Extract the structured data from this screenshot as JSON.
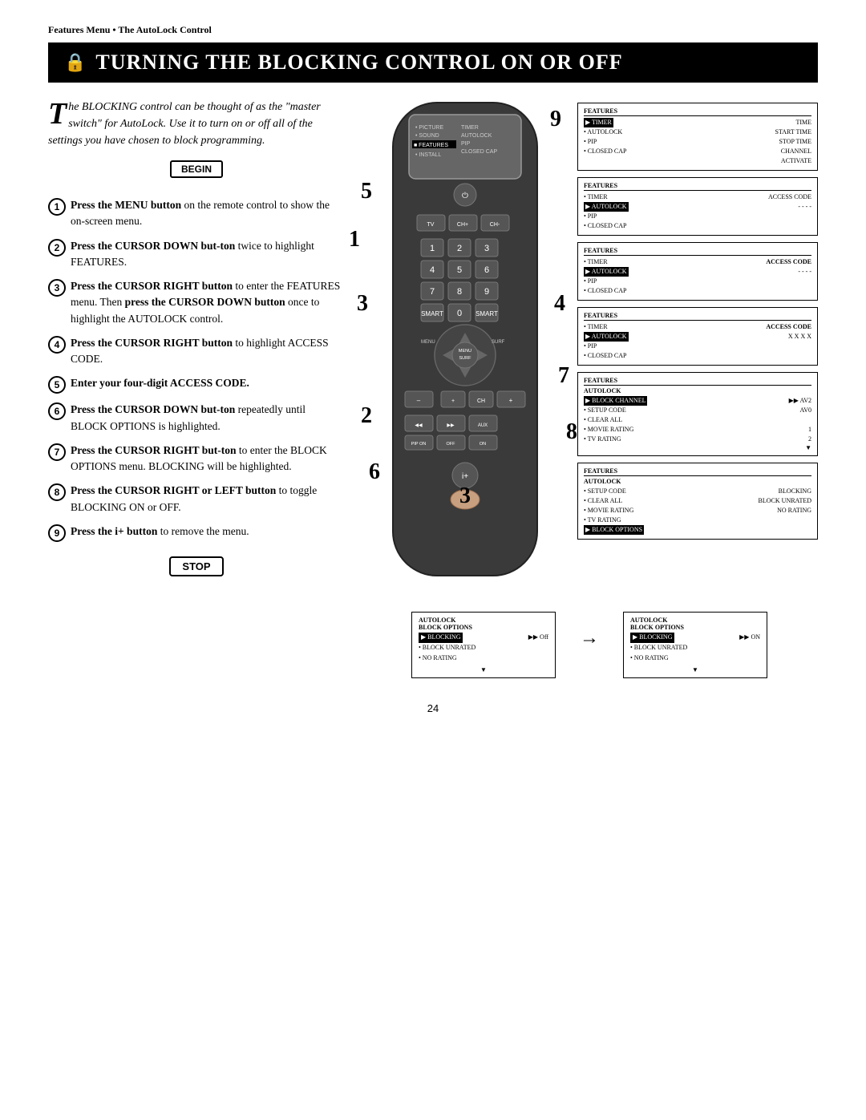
{
  "header": {
    "label": "Features Menu • The AutoLock Control"
  },
  "title": "Turning the Blocking Control On or Off",
  "intro": {
    "drop_cap": "T",
    "text": "he BLOCKING control can be thought of as the \"master switch\" for AutoLock. Use it to turn on or off all of the settings you have chosen to block programming."
  },
  "begin_label": "BEGIN",
  "stop_label": "STOP",
  "steps": [
    {
      "num": "1",
      "text_bold": "Press the MENU button",
      "text_rest": " on the remote control to show the on-screen menu."
    },
    {
      "num": "2",
      "text_bold": "Press the CURSOR DOWN but-ton",
      "text_rest": " twice to highlight FEATURES."
    },
    {
      "num": "3",
      "text_bold": "Press the CURSOR RIGHT button",
      "text_rest": " to enter the FEATURES menu. Then ",
      "text_bold2": "press the CURSOR DOWN button",
      "text_rest2": " once to highlight the AUTOLOCK control."
    },
    {
      "num": "4",
      "text_bold": "Press the CURSOR RIGHT button",
      "text_rest": " to highlight ACCESS CODE."
    },
    {
      "num": "5",
      "text_bold": "Enter your four-digit ACCESS CODE."
    },
    {
      "num": "6",
      "text_bold": "Press the CURSOR DOWN but-ton",
      "text_rest": " repeatedly until BLOCK OPTIONS is highlighted."
    },
    {
      "num": "7",
      "text_bold": "Press the CURSOR RIGHT but-ton",
      "text_rest": " to enter the BLOCK OPTIONS menu. BLOCKING will be highlighted."
    },
    {
      "num": "8",
      "text_bold": "Press the CURSOR RIGHT or LEFT button",
      "text_rest": " to toggle BLOCKING ON or OFF."
    },
    {
      "num": "9",
      "text_bold": "Press the i+ button",
      "text_rest": " to remove the menu."
    }
  ],
  "panels": [
    {
      "id": "panel1",
      "title": "FEATURES",
      "rows": [
        {
          "label": "▶ TIMER",
          "value": "TIME",
          "highlighted": true
        },
        {
          "label": "• AUTOLOCK",
          "value": "START TIME",
          "highlighted": false
        },
        {
          "label": "• PIP",
          "value": "STOP TIME",
          "highlighted": false
        },
        {
          "label": "• CLOSED CAP",
          "value": "CHANNEL",
          "highlighted": false
        },
        {
          "label": "",
          "value": "ACTIVATE",
          "highlighted": false
        }
      ]
    },
    {
      "id": "panel2",
      "title": "FEATURES",
      "rows": [
        {
          "label": "• TIMER",
          "value": "ACCESS CODE",
          "highlighted": false
        },
        {
          "label": "▶ AUTOLOCK",
          "value": "- - - -",
          "highlighted": true
        },
        {
          "label": "• PIP",
          "value": "",
          "highlighted": false
        },
        {
          "label": "• CLOSED CAP",
          "value": "",
          "highlighted": false
        }
      ]
    },
    {
      "id": "panel3",
      "title": "FEATURES",
      "rows": [
        {
          "label": "• TIMER",
          "value": "ACCESS CODE",
          "highlighted": false
        },
        {
          "label": "▶ AUTOLOCK",
          "value": "- - - -",
          "highlighted": true
        },
        {
          "label": "• PIP",
          "value": "",
          "highlighted": false
        },
        {
          "label": "• CLOSED CAP",
          "value": "",
          "highlighted": false
        }
      ]
    },
    {
      "id": "panel4",
      "title": "FEATURES",
      "rows": [
        {
          "label": "• TIMER",
          "value": "ACCESS CODE",
          "highlighted": false
        },
        {
          "label": "▶ AUTOLOCK",
          "value": "X X X X",
          "highlighted": true
        },
        {
          "label": "• PIP",
          "value": "",
          "highlighted": false
        },
        {
          "label": "• CLOSED CAP",
          "value": "",
          "highlighted": false
        }
      ]
    },
    {
      "id": "panel5",
      "title": "FEATURES",
      "sub_title": "AUTOLOCK",
      "rows": [
        {
          "label": "▶ BLOCK CHANNEL",
          "value": "▶▶ AV2",
          "highlighted": true
        },
        {
          "label": "• SETUP CODE",
          "value": "AV0",
          "highlighted": false
        },
        {
          "label": "• CLEAR ALL",
          "value": "",
          "highlighted": false
        },
        {
          "label": "• MOVIE RATING",
          "value": "1",
          "highlighted": false
        },
        {
          "label": "• TV RATING",
          "value": "2",
          "highlighted": false
        },
        {
          "label": "",
          "value": "▼",
          "highlighted": false
        }
      ]
    },
    {
      "id": "panel6",
      "title": "FEATURES",
      "sub_title": "AUTOLOCK",
      "rows": [
        {
          "label": "• SETUP CODE",
          "value": "BLOCKING",
          "highlighted": false
        },
        {
          "label": "• CLEAR ALL",
          "value": "BLOCK UNRATED",
          "highlighted": false
        },
        {
          "label": "• MOVIE RATING",
          "value": "NO RATING",
          "highlighted": false
        },
        {
          "label": "• TV RATING",
          "value": "",
          "highlighted": false
        },
        {
          "label": "▶ BLOCK OPTIONS",
          "value": "",
          "highlighted": true
        }
      ]
    }
  ],
  "bottom_panels": [
    {
      "id": "bp1",
      "title": "AUTOLOCK",
      "sub": "BLOCK OPTIONS",
      "rows": [
        {
          "label": "▶ BLOCKING",
          "value": "▶▶ Off",
          "highlighted": true
        },
        {
          "label": "• BLOCK UNRATED",
          "value": "",
          "highlighted": false
        },
        {
          "label": "• NO RATING",
          "value": "",
          "highlighted": false
        },
        {
          "label": "▼",
          "value": "",
          "highlighted": false
        }
      ]
    },
    {
      "id": "bp2",
      "title": "AUTOLOCK",
      "sub": "BLOCK OPTIONS",
      "rows": [
        {
          "label": "▶ BLOCKING",
          "value": "▶▶ ON",
          "highlighted": true
        },
        {
          "label": "• BLOCK UNRATED",
          "value": "",
          "highlighted": false
        },
        {
          "label": "• NO RATING",
          "value": "",
          "highlighted": false
        },
        {
          "label": "▼",
          "value": "",
          "highlighted": false
        }
      ]
    }
  ],
  "page_number": "24",
  "callouts": [
    "9",
    "5",
    "1",
    "3",
    "4",
    "7",
    "8",
    "6",
    "3",
    "2"
  ]
}
